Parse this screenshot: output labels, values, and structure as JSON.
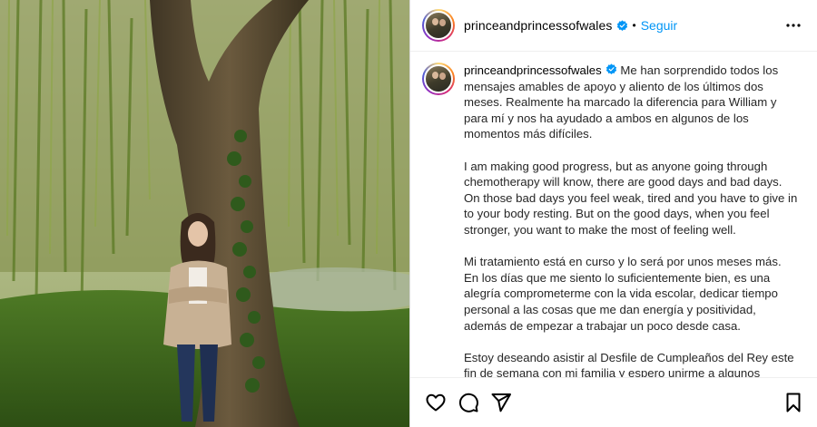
{
  "account": {
    "username": "princeandprincessofwales",
    "separator": "•",
    "follow_label": "Seguir"
  },
  "caption": {
    "username": "princeandprincessofwales",
    "paragraphs": [
      "Me han sorprendido todos los mensajes amables de apoyo y aliento de los últimos dos meses. Realmente ha marcado la diferencia para William y para mí y nos ha ayudado a ambos en algunos de los momentos más difíciles.",
      "I am making good progress, but as anyone going through chemotherapy will know, there are good days and bad days. On those bad days you feel weak, tired and you have to give in to your body resting. But on the good days, when you feel stronger, you want to make the most of feeling well.",
      "Mi tratamiento está en curso y lo será por unos meses más. En los días que me siento lo suficientemente bien, es una alegría comprometerme con la vida escolar, dedicar tiempo personal a las cosas que me dan energía y positividad, además de empezar a trabajar un poco desde casa.",
      "Estoy deseando asistir al Desfile de Cumpleaños del Rey este fin de semana con mi familia y espero unirme a algunos compromisos públicos durante el verano, pero también sabiendo que aún no estoy fuera de peligro."
    ]
  },
  "icons": {
    "verified": "verified-badge-icon",
    "more": "more-options-icon",
    "like": "heart-icon",
    "comment": "comment-icon",
    "share": "share-icon",
    "save": "bookmark-icon"
  },
  "colors": {
    "accent": "#0095f6",
    "verified": "#0095f6",
    "text": "#262626",
    "border": "#dbdbdb"
  }
}
